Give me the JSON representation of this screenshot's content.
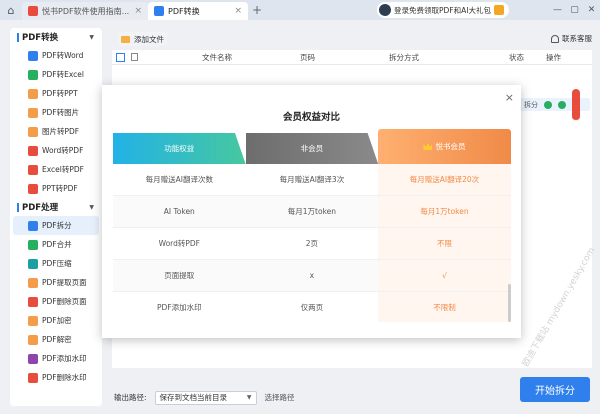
{
  "titlebar": {
    "tabs": [
      {
        "label": "悦书PDF软件使用指南...",
        "active": false
      },
      {
        "label": "PDF转换",
        "active": true
      }
    ],
    "promo": "登录免费领取PDF和AI大礼包",
    "window_buttons": [
      "—",
      "▢",
      "✕"
    ]
  },
  "sidebar": {
    "sections": [
      {
        "title": "PDF转换",
        "items": [
          "PDF转Word",
          "PDF转Excel",
          "PDF转PPT",
          "PDF转图片",
          "图片转PDF",
          "Word转PDF",
          "Excel转PDF",
          "PPT转PDF"
        ]
      },
      {
        "title": "PDF处理",
        "items": [
          "PDF拆分",
          "PDF合并",
          "PDF压缩",
          "PDF提取页面",
          "PDF删除页面",
          "PDF加密",
          "PDF解密",
          "PDF添加水印",
          "PDF删除水印"
        ]
      }
    ],
    "active_item": "PDF拆分"
  },
  "toolbar": {
    "add_file": "添加文件",
    "support": "联系客服"
  },
  "table": {
    "columns": [
      "文件名称",
      "页码",
      "拆分方式",
      "状态",
      "操作"
    ],
    "row_status": "拆分"
  },
  "bottom": {
    "output_label": "输出路径:",
    "output_value": "保存到文档当前目录",
    "choose_path": "选择路径",
    "start_button": "开始拆分"
  },
  "modal": {
    "title": "会员权益对比",
    "headers": [
      "功能权益",
      "非会员",
      "悦书会员"
    ],
    "rows": [
      [
        "每月赠送AI翻译次数",
        "每月赠送AI翻译3次",
        "每月赠送AI翻译20次"
      ],
      [
        "AI Token",
        "每月1万token",
        "每月1万token"
      ],
      [
        "Word转PDF",
        "2页",
        "不限"
      ],
      [
        "页面提取",
        "x",
        "√"
      ],
      [
        "PDF添加水印",
        "仅两页",
        "不限制"
      ]
    ],
    "close": "×"
  },
  "watermark": "欧迪下载站 mydown.yesky.com",
  "colors": {
    "accent": "#2f80ed",
    "vip": "#f08a48"
  }
}
